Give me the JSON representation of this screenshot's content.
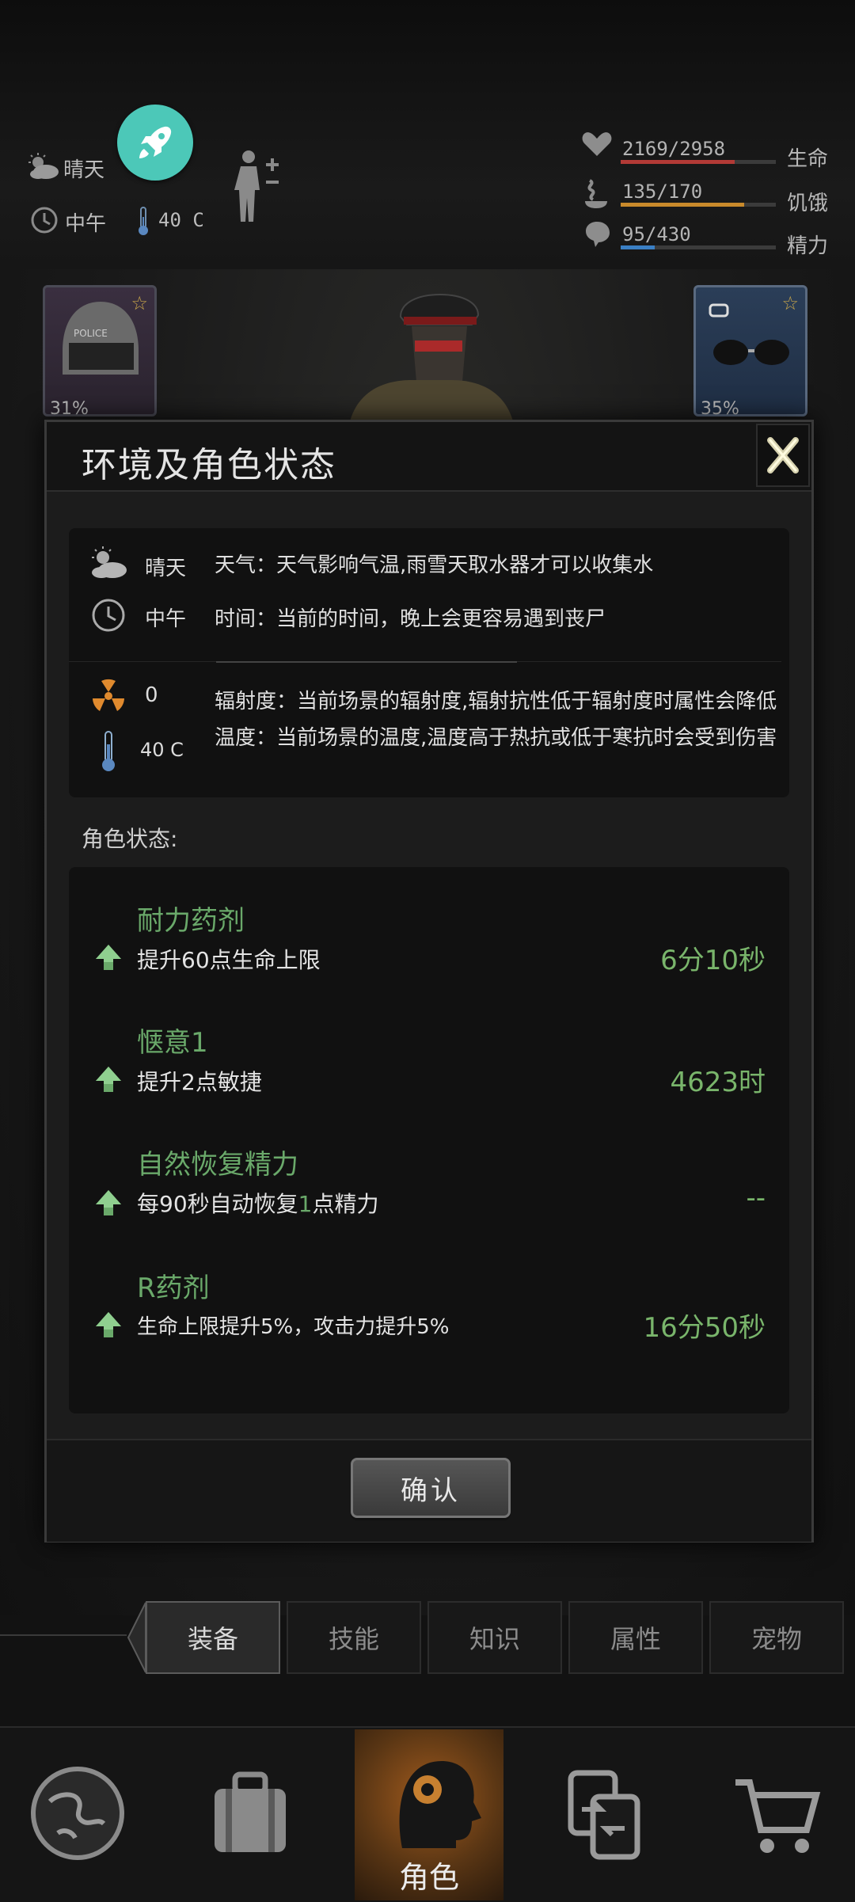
{
  "status": {
    "weather": "晴天",
    "time": "中午",
    "temperature": "40 C"
  },
  "stats": [
    {
      "value": "2169/2958",
      "label": "生命",
      "fraction": 0.733,
      "color": "#b23a36"
    },
    {
      "value": "135/170",
      "label": "饥饿",
      "fraction": 0.794,
      "color": "#c98a2b"
    },
    {
      "value": "95/430",
      "label": "精力",
      "fraction": 0.221,
      "color": "#3a7fc4"
    }
  ],
  "equipment": {
    "left_durability": "31%",
    "right_durability": "35%"
  },
  "modal": {
    "title": "环境及角色状态",
    "environment": [
      {
        "icon": "sun-cloud-icon",
        "value": "晴天",
        "desc": "天气：天气影响气温,雨雪天取水器才可以收集水"
      },
      {
        "icon": "clock-icon",
        "value": "中午",
        "desc": "时间：当前的时间，晚上会更容易遇到丧尸"
      },
      {
        "icon": "radiation-icon",
        "value": "0",
        "desc": "辐射度：当前场景的辐射度,辐射抗性低于辐射度时属性会降低"
      },
      {
        "icon": "thermometer-icon",
        "value": "40 C",
        "desc": "温度：当前场景的温度,温度高于热抗或低于寒抗时会受到伤害"
      }
    ],
    "section_label": "角色状态:",
    "effects": [
      {
        "name": "耐力药剂",
        "desc": "提升60点生命上限",
        "time": "6分10秒"
      },
      {
        "name": "惬意1",
        "desc": "提升2点敏捷",
        "time": "4623时"
      },
      {
        "name": "自然恢复精力",
        "desc_pre": "每90秒自动恢复",
        "desc_hl": "1",
        "desc_post": "点精力",
        "time": "--"
      },
      {
        "name": "R药剂",
        "desc": "生命上限提升5%，攻击力提升5%",
        "time": "16分50秒"
      }
    ],
    "confirm": "确认"
  },
  "tabs": [
    {
      "label": "装备",
      "active": true
    },
    {
      "label": "技能",
      "active": false
    },
    {
      "label": "知识",
      "active": false
    },
    {
      "label": "属性",
      "active": false
    },
    {
      "label": "宠物",
      "active": false
    }
  ],
  "nav": {
    "active_label": "角色",
    "items": [
      "map-icon",
      "backpack-icon",
      "character-icon",
      "trade-icon",
      "shop-icon"
    ]
  },
  "colors": {
    "accent_green": "#6aa96a",
    "rocket_bg": "#4cc8b8"
  }
}
